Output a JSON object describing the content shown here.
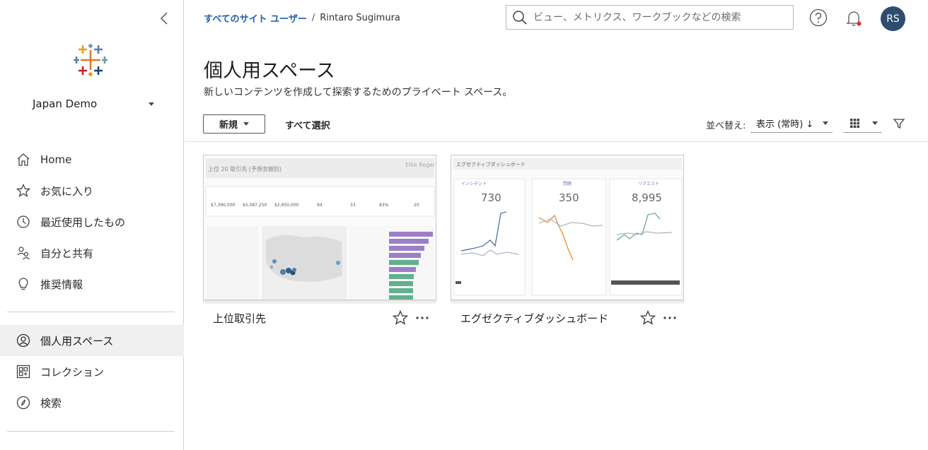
{
  "sidebar": {
    "site_name": "Japan Demo",
    "items": [
      {
        "label": "Home",
        "icon": "home-icon"
      },
      {
        "label": "お気に入り",
        "icon": "star-icon"
      },
      {
        "label": "最近使用したもの",
        "icon": "clock-icon"
      },
      {
        "label": "自分と共有",
        "icon": "shared-users-icon"
      },
      {
        "label": "推奨情報",
        "icon": "lightbulb-icon"
      }
    ],
    "items2": [
      {
        "label": "個人用スペース",
        "icon": "user-circle-icon",
        "active": true
      },
      {
        "label": "コレクション",
        "icon": "collection-icon"
      },
      {
        "label": "検索",
        "icon": "compass-icon"
      }
    ]
  },
  "topbar": {
    "breadcrumb_link": "すべてのサイト ユーザー",
    "breadcrumb_sep": "/",
    "breadcrumb_current": "Rintaro Sugimura",
    "search_placeholder": "ビュー、メトリクス、ワークブックなどの検索",
    "avatar_initials": "RS",
    "notification_color": "#d9342b"
  },
  "header": {
    "title": "個人用スペース",
    "subtitle": "新しいコンテンツを作成して探索するためのプライベート スペース。"
  },
  "toolbar": {
    "new_label": "新規",
    "select_all_label": "すべて選択",
    "sort_label": "並べ替え:",
    "sort_value": "表示 (常時) ↓"
  },
  "cards": [
    {
      "title": "上位取引先",
      "thumb": {
        "header": "上位 20 取引先 (予想金額別)",
        "owner": "Ellie Rogers...",
        "kpis": [
          "$7,390,000",
          "$5,087,250",
          "$2,950,000",
          "94",
          "33",
          "83%",
          "20"
        ]
      }
    },
    {
      "title": "エグゼクティブダッシュボード",
      "thumb": {
        "header": "エグゼクティブダッシュボード",
        "panels": [
          {
            "label": "インシデント",
            "value": "730"
          },
          {
            "label": "問題",
            "value": "350"
          },
          {
            "label": "リクエスト",
            "value": "8,995"
          }
        ]
      }
    }
  ],
  "colors": {
    "accent": "#1f5ea8",
    "avatar_bg": "#2e4c6d",
    "active_nav_bg": "#f0f0f0"
  }
}
